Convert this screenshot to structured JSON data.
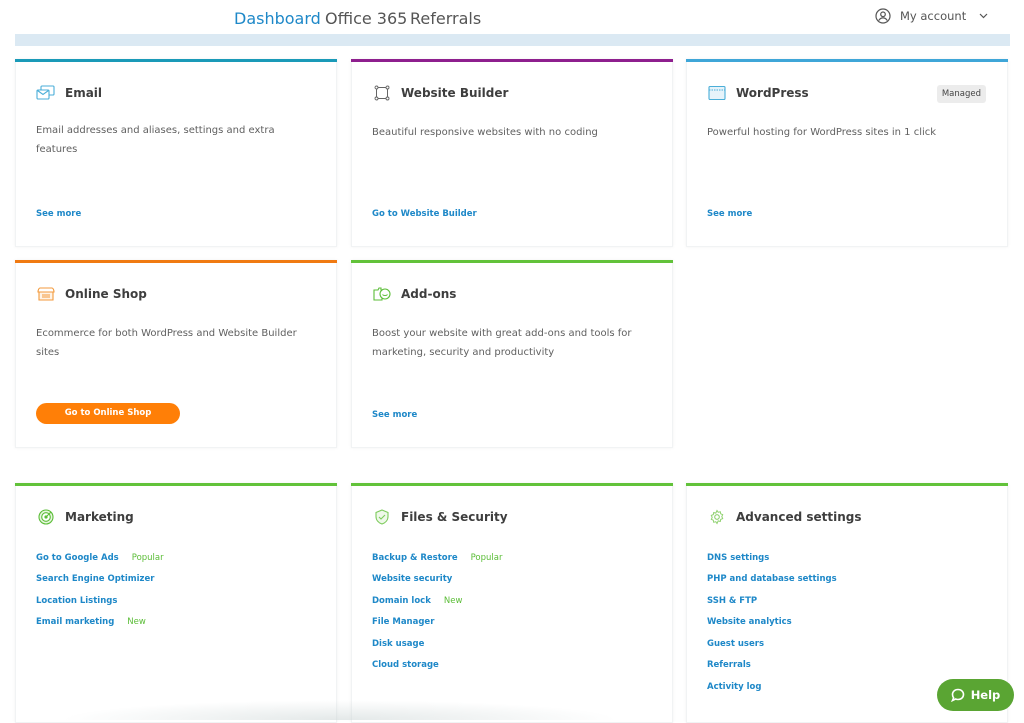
{
  "nav": {
    "items": [
      {
        "label": "Dashboard",
        "active": true
      },
      {
        "label": "Office 365",
        "active": false
      },
      {
        "label": "Referrals",
        "active": false
      }
    ],
    "account_label": "My account"
  },
  "colors": {
    "link": "#1e88c8",
    "email_bar": "#1a9ab8",
    "website_builder_bar": "#8e1f8e",
    "wordpress_bar": "#3fa6d8",
    "online_shop_bar": "#f07a12",
    "green_bar": "#62c23a",
    "orange_button": "#ff7f07",
    "help_button": "#5aa533",
    "tag_green": "#5bbd37"
  },
  "products": {
    "email": {
      "title": "Email",
      "icon": "email-icon",
      "description": "Email addresses and aliases, settings and extra features",
      "link": "See more"
    },
    "website_builder": {
      "title": "Website Builder",
      "icon": "website-builder-icon",
      "description": "Beautiful responsive websites with no coding",
      "link": "Go to Website Builder"
    },
    "wordpress": {
      "title": "WordPress",
      "icon": "browser-window-icon",
      "badge": "Managed",
      "description": "Powerful hosting for WordPress sites in 1 click",
      "link": "See more"
    },
    "online_shop": {
      "title": "Online Shop",
      "icon": "shop-icon",
      "description": "Ecommerce for both WordPress and Website Builder sites",
      "button": "Go to Online Shop"
    },
    "addons": {
      "title": "Add-ons",
      "icon": "addons-icon",
      "description": "Boost your website with great add-ons and tools for marketing, security and productivity",
      "link": "See more"
    }
  },
  "sections": {
    "marketing": {
      "title": "Marketing",
      "icon": "target-icon",
      "links": [
        {
          "label": "Go to Google Ads",
          "tag": "Popular"
        },
        {
          "label": "Search Engine Optimizer",
          "tag": ""
        },
        {
          "label": "Location Listings",
          "tag": ""
        },
        {
          "label": "Email marketing",
          "tag": "New"
        }
      ]
    },
    "files_security": {
      "title": "Files & Security",
      "icon": "shield-icon",
      "links": [
        {
          "label": "Backup & Restore",
          "tag": "Popular"
        },
        {
          "label": "Website security",
          "tag": ""
        },
        {
          "label": "Domain lock",
          "tag": "New"
        },
        {
          "label": "File Manager",
          "tag": ""
        },
        {
          "label": "Disk usage",
          "tag": ""
        },
        {
          "label": "Cloud storage",
          "tag": ""
        }
      ]
    },
    "advanced": {
      "title": "Advanced settings",
      "icon": "gear-icon",
      "links": [
        {
          "label": "DNS settings",
          "tag": ""
        },
        {
          "label": "PHP and database settings",
          "tag": ""
        },
        {
          "label": "SSH & FTP",
          "tag": ""
        },
        {
          "label": "Website analytics",
          "tag": ""
        },
        {
          "label": "Guest users",
          "tag": ""
        },
        {
          "label": "Referrals",
          "tag": ""
        },
        {
          "label": "Activity log",
          "tag": ""
        }
      ]
    }
  },
  "help": {
    "label": "Help"
  }
}
